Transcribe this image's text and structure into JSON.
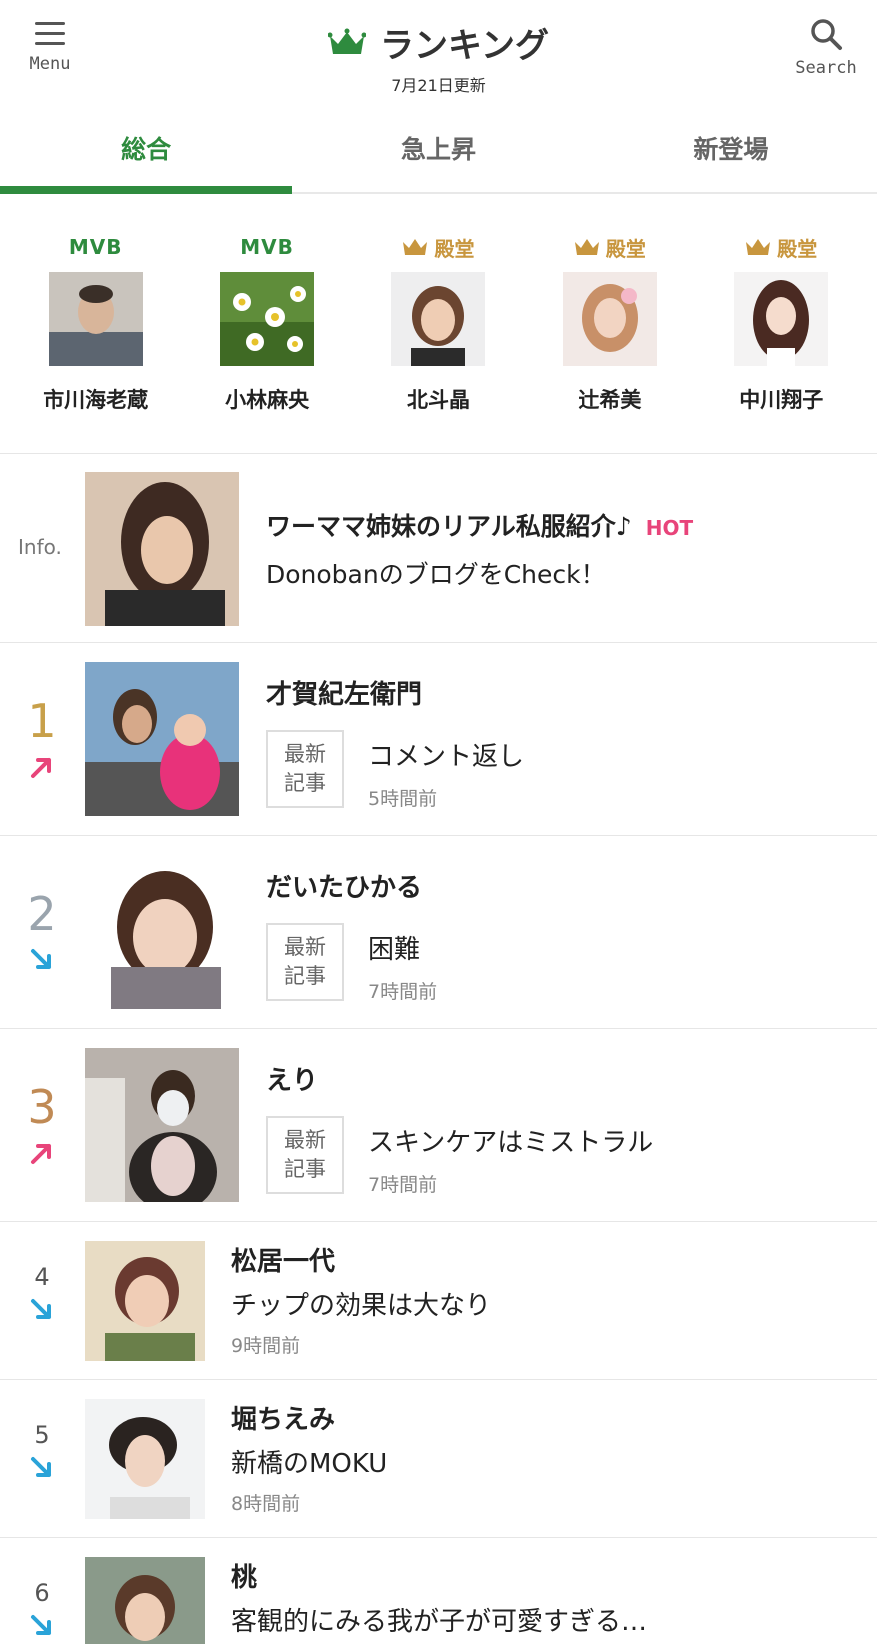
{
  "header": {
    "menu_label": "Menu",
    "title": "ランキング",
    "updated": "7月21日更新",
    "search_label": "Search",
    "accent_color": "#2e8b3e"
  },
  "tabs": [
    {
      "label": "総合",
      "active": true
    },
    {
      "label": "急上昇",
      "active": false
    },
    {
      "label": "新登場",
      "active": false
    }
  ],
  "featured": [
    {
      "badge": "MVB",
      "badge_type": "mvb",
      "name": "市川海老蔵"
    },
    {
      "badge": "MVB",
      "badge_type": "mvb",
      "name": "小林麻央"
    },
    {
      "badge": "殿堂",
      "badge_type": "hall-of-fame",
      "name": "北斗晶"
    },
    {
      "badge": "殿堂",
      "badge_type": "hall-of-fame",
      "name": "辻希美"
    },
    {
      "badge": "殿堂",
      "badge_type": "hall-of-fame",
      "name": "中川翔子"
    }
  ],
  "info": {
    "label": "Info.",
    "title": "ワーママ姉妹のリアル私服紹介♪",
    "hot": "HOT",
    "subtitle": "DonobanのブログをCheck！"
  },
  "latest_label_line1": "最新",
  "latest_label_line2": "記事",
  "ranking": [
    {
      "rank": "1",
      "trend": "up",
      "name": "才賀紀左衛門",
      "entry": "コメント返し",
      "time": "5時間前"
    },
    {
      "rank": "2",
      "trend": "down",
      "name": "だいたひかる",
      "entry": "困難",
      "time": "7時間前"
    },
    {
      "rank": "3",
      "trend": "up",
      "name": "えり",
      "entry": "スキンケアはミストラル",
      "time": "7時間前"
    },
    {
      "rank": "4",
      "trend": "down",
      "name": "松居一代",
      "entry": "チップの効果は大なり",
      "time": "9時間前"
    },
    {
      "rank": "5",
      "trend": "down",
      "name": "堀ちえみ",
      "entry": "新橋のMOKU",
      "time": "8時間前"
    },
    {
      "rank": "6",
      "trend": "down",
      "name": "桃",
      "entry": "客観的にみる我が子が可愛すぎる…",
      "time": ""
    }
  ],
  "colors": {
    "rank_1": "#c8a04a",
    "rank_2": "#9aa4ad",
    "rank_3": "#c08a55",
    "trend_up": "#e8447a",
    "trend_down": "#2aa3d8",
    "hot": "#e8447a",
    "hall_of_fame": "#c8963e"
  }
}
